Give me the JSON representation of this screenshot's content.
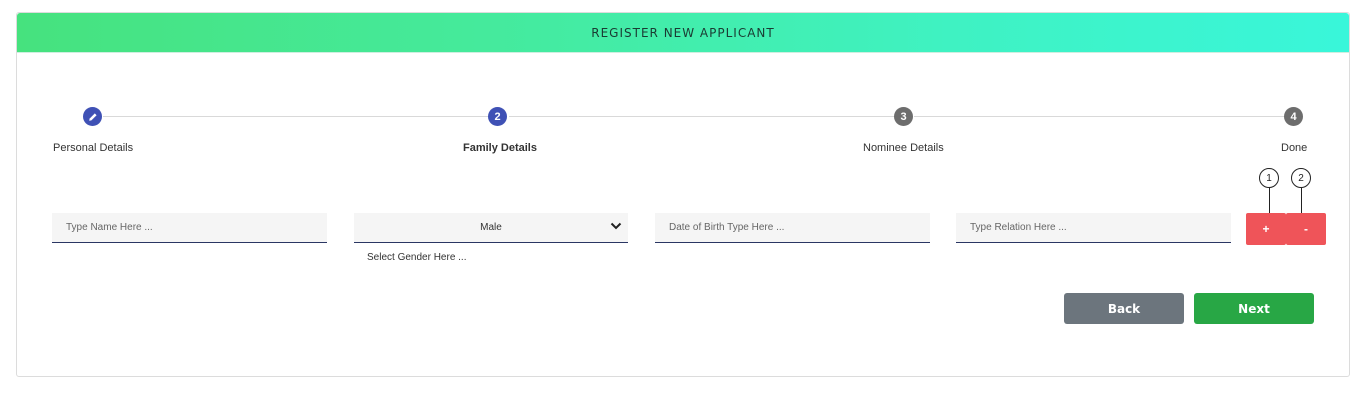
{
  "header": {
    "title": "REGISTER NEW APPLICANT"
  },
  "stepper": {
    "steps": [
      {
        "number": "✎",
        "label": "Personal Details",
        "state": "completed"
      },
      {
        "number": "2",
        "label": "Family Details",
        "state": "current"
      },
      {
        "number": "3",
        "label": "Nominee Details",
        "state": "upcoming"
      },
      {
        "number": "4",
        "label": "Done",
        "state": "upcoming"
      }
    ]
  },
  "form": {
    "name": {
      "value": "",
      "placeholder": "Type Name Here ..."
    },
    "gender": {
      "selected": "Male",
      "helper": "Select Gender Here ..."
    },
    "dob": {
      "value": "",
      "placeholder": "Date of Birth Type Here ..."
    },
    "relation": {
      "value": "",
      "placeholder": "Type Relation Here ..."
    },
    "add_label": "+",
    "remove_label": "-"
  },
  "markers": {
    "one": "1",
    "two": "2"
  },
  "actions": {
    "back_label": "Back",
    "next_label": "Next"
  },
  "colors": {
    "header_start": "#46e27e",
    "header_end": "#39f6da",
    "step_active": "#3f51b5",
    "step_inactive": "#6d6d6d",
    "danger": "#ef5459",
    "back": "#6c757d",
    "next": "#28a745"
  }
}
